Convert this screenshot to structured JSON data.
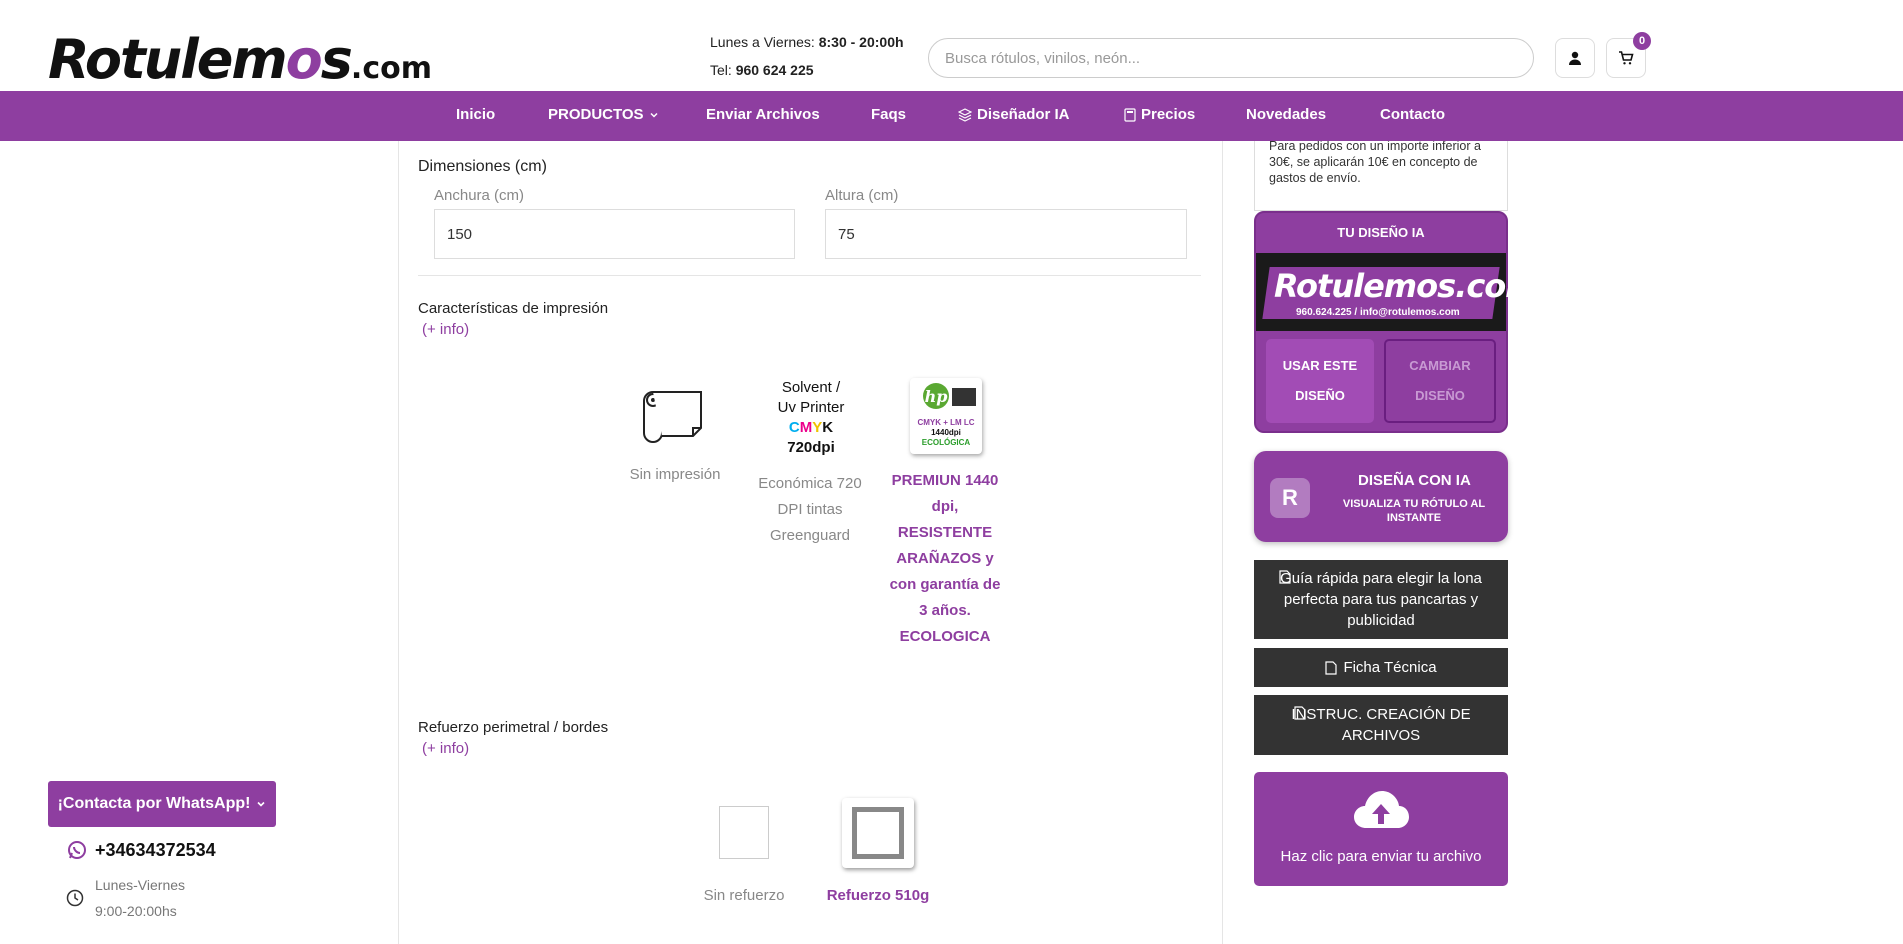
{
  "header": {
    "logo_text": "Rotulemos",
    "logo_suffix": ".com",
    "hours_prefix": "Lunes a Viernes:",
    "hours_value": "8:30 - 20:00h",
    "tel_prefix": "Tel:",
    "tel_value": "960 624 225",
    "search_placeholder": "Busca rótulos, vinilos, neón...",
    "cart_count": "0"
  },
  "nav": {
    "items": [
      "Inicio",
      "PRODUCTOS",
      "Enviar Archivos",
      "Faqs",
      "Diseñador IA",
      "Precios",
      "Novedades",
      "Contacto"
    ]
  },
  "dimensions": {
    "title": "Dimensiones (cm)",
    "width_label": "Anchura (cm)",
    "width_value": "150",
    "height_label": "Altura (cm)",
    "height_value": "75"
  },
  "print": {
    "title": "Características de impresión",
    "info_link": "(+ info)",
    "options": [
      {
        "label": "Sin impresión",
        "selected": false
      },
      {
        "label": "Económica 720 DPI tintas Greenguard",
        "image_text": "Solvent / Uv Printer CMYK 720dpi",
        "selected": false
      },
      {
        "label": "PREMIUN 1440 dpi, RESISTENTE ARAÑAZOS y con garantía de 3 años. ECOLOGICA",
        "image_text": "hp CMYK + LM LC 1440dpi ECOLÓGICA",
        "selected": true
      }
    ],
    "solvent_line1": "Solvent /",
    "solvent_line2": "Uv Printer",
    "solvent_cmyk": "CMYK",
    "solvent_dpi": "720dpi",
    "hp_line1": "CMYK + LM LC",
    "hp_line2": "1440dpi",
    "hp_line3": "ECOLÓGICA"
  },
  "reinforcement": {
    "title": "Refuerzo perimetral / bordes",
    "info_link": "(+ info)",
    "options": [
      {
        "label": "Sin refuerzo",
        "selected": false
      },
      {
        "label": "Refuerzo 510g",
        "selected": true
      }
    ]
  },
  "sidebar": {
    "shipping_note": "Para pedidos con un importe inferior a 30€, se aplicarán 10€ en concepto de gastos de envío.",
    "ai_design_title": "TU DISEÑO IA",
    "ai_preview_logo": "Rotulemos.com",
    "ai_preview_contact": "960.624.225 / info@rotulemos.com",
    "use_design_btn": "USAR ESTE DISEÑO",
    "change_design_btn": "CAMBIAR DISEÑO",
    "ai_banner_title": "DISEÑA CON IA",
    "ai_banner_sub": "VISUALIZA TU RÓTULO AL INSTANTE",
    "ai_banner_letter": "R",
    "guide_btn": "Guía rápida para elegir la lona perfecta para tus pancartas y publicidad",
    "datasheet_btn": "Ficha Técnica",
    "instructions_btn": "INSTRUC. CREACIÓN DE ARCHIVOS",
    "upload_text": "Haz clic para enviar tu archivo"
  },
  "whatsapp": {
    "button": "¡Contacta por WhatsApp!",
    "phone": "+34634372534",
    "days": "Lunes-Viernes",
    "hours": "9:00-20:00hs"
  },
  "colors": {
    "brand_purple": "#8e3ea0",
    "dark_button": "#333333"
  }
}
